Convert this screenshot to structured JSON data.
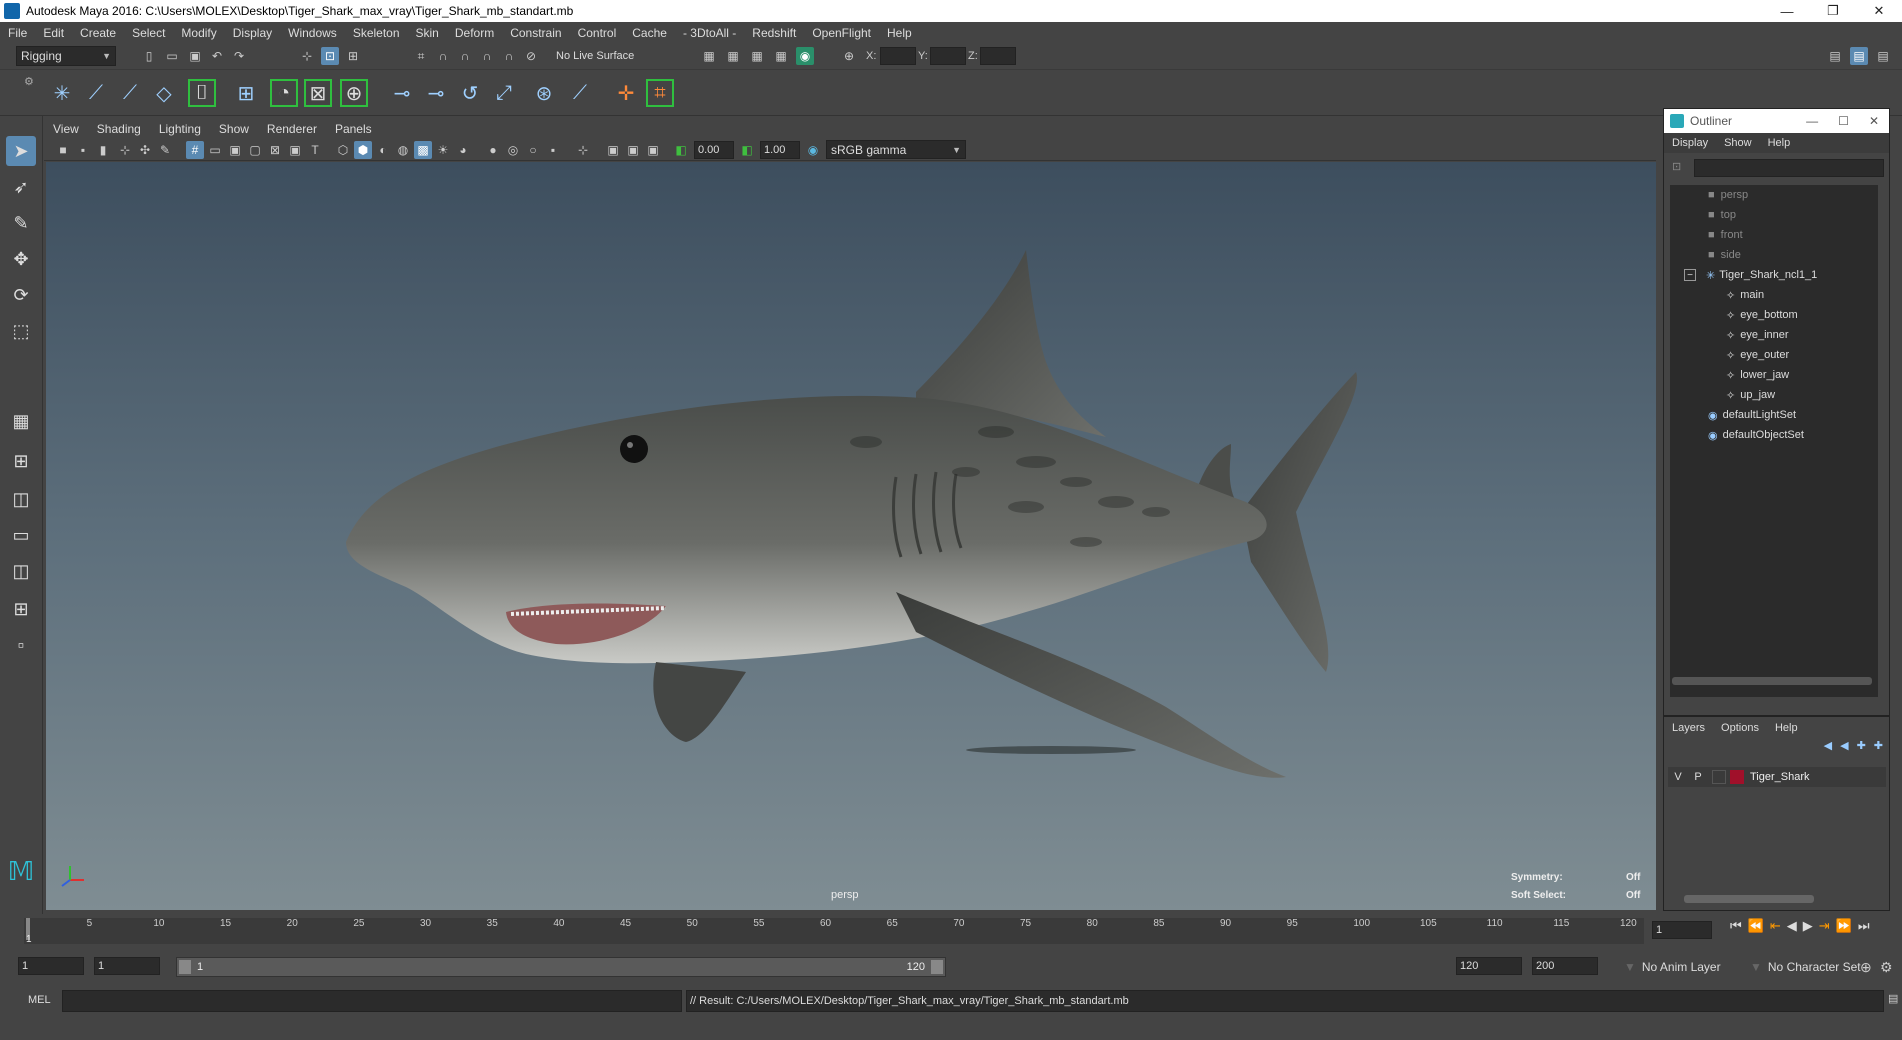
{
  "window": {
    "title": "Autodesk Maya 2016: C:\\Users\\MOLEX\\Desktop\\Tiger_Shark_max_vray\\Tiger_Shark_mb_standart.mb",
    "minimize": "—",
    "restore": "❐",
    "close": "✕"
  },
  "menubar": [
    "File",
    "Edit",
    "Create",
    "Select",
    "Modify",
    "Display",
    "Windows",
    "Skeleton",
    "Skin",
    "Deform",
    "Constrain",
    "Control",
    "Cache",
    "- 3DtoAll -",
    "Redshift",
    "OpenFlight",
    "Help"
  ],
  "statusline": {
    "menuset": "Rigging",
    "live_surface": "No Live Surface",
    "x_label": "X:",
    "y_label": "Y:",
    "z_label": "Z:"
  },
  "viewport": {
    "menus": [
      "View",
      "Shading",
      "Lighting",
      "Show",
      "Renderer",
      "Panels"
    ],
    "exposure": "0.00",
    "gamma": "1.00",
    "color_space": "sRGB gamma",
    "camera_label": "persp",
    "symmetry_label": "Symmetry:",
    "symmetry_value": "Off",
    "soft_select_label": "Soft Select:",
    "soft_select_value": "Off"
  },
  "outliner": {
    "title": "Outliner",
    "menus": [
      "Display",
      "Show",
      "Help"
    ],
    "items": [
      {
        "label": "persp",
        "icon": "camera-icon",
        "dim": true
      },
      {
        "label": "top",
        "icon": "camera-icon",
        "dim": true
      },
      {
        "label": "front",
        "icon": "camera-icon",
        "dim": true
      },
      {
        "label": "side",
        "icon": "camera-icon",
        "dim": true
      },
      {
        "label": "Tiger_Shark_ncl1_1",
        "icon": "joint-icon",
        "dim": false,
        "expander": "−"
      },
      {
        "label": "main",
        "icon": "mesh-icon",
        "dim": false
      },
      {
        "label": "eye_bottom",
        "icon": "mesh-icon",
        "dim": false
      },
      {
        "label": "eye_inner",
        "icon": "mesh-icon",
        "dim": false
      },
      {
        "label": "eye_outer",
        "icon": "mesh-icon",
        "dim": false
      },
      {
        "label": "lower_jaw",
        "icon": "mesh-icon",
        "dim": false
      },
      {
        "label": "up_jaw",
        "icon": "mesh-icon",
        "dim": false
      },
      {
        "label": "defaultLightSet",
        "icon": "set-icon",
        "dim": false
      },
      {
        "label": "defaultObjectSet",
        "icon": "set-icon",
        "dim": false
      }
    ]
  },
  "layers": {
    "menus": [
      "Layers",
      "Options",
      "Help"
    ],
    "rows": [
      {
        "v": "V",
        "p": "P",
        "name": "Tiger_Shark",
        "color": "#a0102a"
      }
    ]
  },
  "timeline": {
    "ticks": [
      "5",
      "10",
      "15",
      "20",
      "25",
      "30",
      "35",
      "40",
      "45",
      "50",
      "55",
      "60",
      "65",
      "70",
      "75",
      "80",
      "85",
      "90",
      "95",
      "100",
      "105",
      "110",
      "115",
      "120"
    ],
    "start_tick": "1",
    "current_frame": "1"
  },
  "range": {
    "start": "1",
    "playback_start": "1",
    "slider_start": "1",
    "slider_end": "120",
    "playback_end": "120",
    "end": "200",
    "anim_layer": "No Anim Layer",
    "character_set": "No Character Set"
  },
  "command": {
    "lang": "MEL",
    "result": "// Result: C:/Users/MOLEX/Desktop/Tiger_Shark_max_vray/Tiger_Shark_mb_standart.mb"
  },
  "colors": {
    "accent": "#5b8ab2",
    "shelf_green": "#2fbf3f",
    "layer_red": "#a0102a"
  }
}
